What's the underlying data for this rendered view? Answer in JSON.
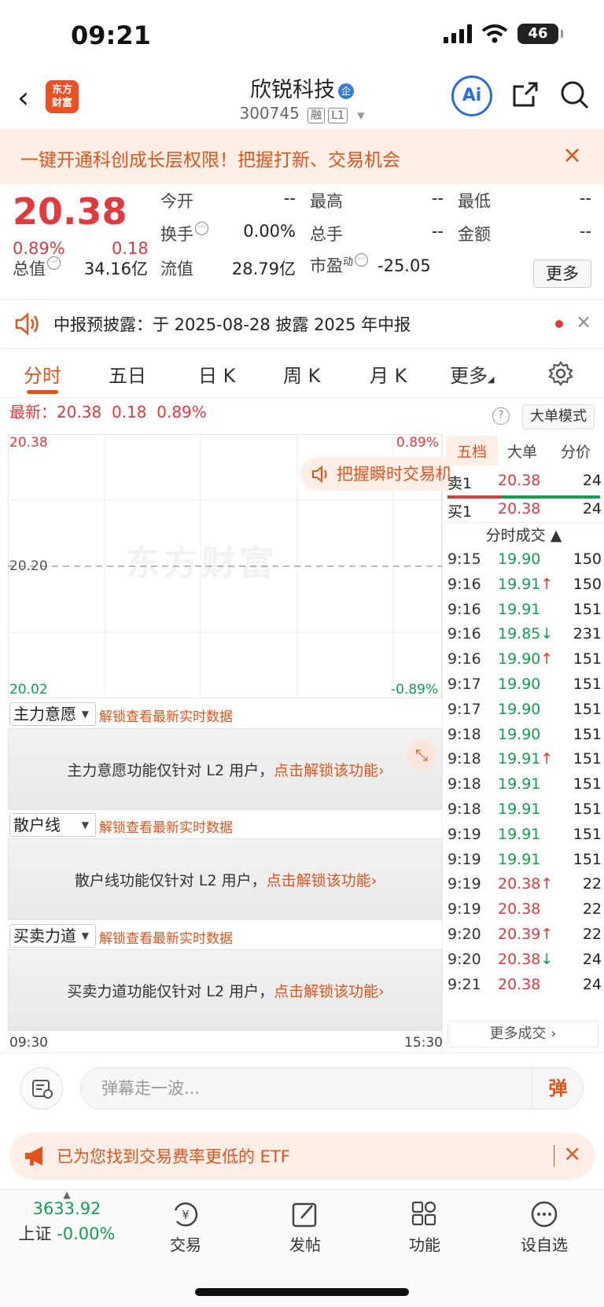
{
  "status": {
    "time": "09:21",
    "battery": "46"
  },
  "nav": {
    "back": "‹",
    "logo_line1": "东方",
    "logo_line2": "财富",
    "stock_name": "欣锐科技",
    "badge": "企",
    "stock_code": "300745",
    "tag_rong": "融",
    "tag_l1": "L1",
    "ai": "Ai"
  },
  "promo": {
    "text": "一键开通科创成长层权限！把握打新、交易机会",
    "close": "×"
  },
  "quote": {
    "price": "20.38",
    "pct": "0.89%",
    "chg": "0.18",
    "fields": [
      {
        "label": "今开",
        "value": "--"
      },
      {
        "label": "最高",
        "value": "--"
      },
      {
        "label": "最低",
        "value": "--"
      },
      {
        "label": "换手",
        "value": "0.00%"
      },
      {
        "label": "总手",
        "value": "--"
      },
      {
        "label": "金额",
        "value": "--"
      },
      {
        "label": "总值",
        "value": "34.16亿"
      },
      {
        "label": "流值",
        "value": "28.79亿"
      },
      {
        "label": "市盈",
        "sup": "动",
        "value": "-25.05"
      }
    ],
    "more": "更多"
  },
  "notice": {
    "text": "中报预披露：于 2025-08-28 披露 2025 年中报",
    "close": "×"
  },
  "tabs": [
    "分时",
    "五日",
    "日 K",
    "周 K",
    "月 K",
    "更多"
  ],
  "latest": {
    "label": "最新：",
    "price": "20.38",
    "chg": "0.18",
    "pct": "0.89%"
  },
  "bigmode": "大单模式",
  "help": "?",
  "chart": {
    "y_top": "20.38",
    "y_mid": "20.20",
    "y_bottom": "20.02",
    "pct_top": "0.89%",
    "pct_bottom": "-0.89%",
    "watermark": "东方财富",
    "pill": "把握瞬时交易机会",
    "time_start": "09:30",
    "time_end": "15:30"
  },
  "sections": [
    {
      "name": "主力意愿",
      "unlock": "解锁查看最新实时数据",
      "msg": "主力意愿功能仅针对 L2 用户，",
      "link": "点击解锁该功能›"
    },
    {
      "name": "散户线",
      "unlock": "解锁查看最新实时数据",
      "msg": "散户线功能仅针对 L2 用户，",
      "link": "点击解锁该功能›"
    },
    {
      "name": "买卖力道",
      "unlock": "解锁查看最新实时数据",
      "msg": "买卖力道功能仅针对 L2 用户，",
      "link": "点击解锁该功能›"
    }
  ],
  "right_panel": {
    "tabs": [
      "五档",
      "大单",
      "分价"
    ],
    "sell1": {
      "label": "卖1",
      "price": "20.38",
      "vol": "24"
    },
    "buy1": {
      "label": "买1",
      "price": "20.38",
      "vol": "24"
    },
    "ticks_title": "分时成交 ▲",
    "ticks": [
      {
        "t": "9:15",
        "p": "19.90",
        "arrow": "",
        "v": "150",
        "c": "green"
      },
      {
        "t": "9:16",
        "p": "19.91",
        "arrow": "↑",
        "v": "150",
        "c": "green"
      },
      {
        "t": "9:16",
        "p": "19.91",
        "arrow": "",
        "v": "151",
        "c": "green"
      },
      {
        "t": "9:16",
        "p": "19.85",
        "arrow": "↓",
        "v": "231",
        "c": "green"
      },
      {
        "t": "9:16",
        "p": "19.90",
        "arrow": "↑",
        "v": "151",
        "c": "green"
      },
      {
        "t": "9:17",
        "p": "19.90",
        "arrow": "",
        "v": "151",
        "c": "green"
      },
      {
        "t": "9:17",
        "p": "19.90",
        "arrow": "",
        "v": "151",
        "c": "green"
      },
      {
        "t": "9:18",
        "p": "19.90",
        "arrow": "",
        "v": "151",
        "c": "green"
      },
      {
        "t": "9:18",
        "p": "19.91",
        "arrow": "↑",
        "v": "151",
        "c": "green"
      },
      {
        "t": "9:18",
        "p": "19.91",
        "arrow": "",
        "v": "151",
        "c": "green"
      },
      {
        "t": "9:18",
        "p": "19.91",
        "arrow": "",
        "v": "151",
        "c": "green"
      },
      {
        "t": "9:19",
        "p": "19.91",
        "arrow": "",
        "v": "151",
        "c": "green"
      },
      {
        "t": "9:19",
        "p": "19.91",
        "arrow": "",
        "v": "151",
        "c": "green"
      },
      {
        "t": "9:19",
        "p": "20.38",
        "arrow": "↑",
        "v": "22",
        "c": "red"
      },
      {
        "t": "9:19",
        "p": "20.38",
        "arrow": "",
        "v": "22",
        "c": "red"
      },
      {
        "t": "9:20",
        "p": "20.39",
        "arrow": "↑",
        "v": "22",
        "c": "red"
      },
      {
        "t": "9:20",
        "p": "20.38",
        "arrow": "↓",
        "v": "24",
        "c": "red"
      },
      {
        "t": "9:21",
        "p": "20.38",
        "arrow": "",
        "v": "24",
        "c": "red"
      }
    ],
    "more_ticks": "更多成交 ›"
  },
  "danmu": {
    "placeholder": "弹幕走一波...",
    "send": "弹"
  },
  "etf": {
    "text": "已为您找到交易费率更低的 ETF",
    "close": "×"
  },
  "bottom_nav": {
    "index_value": "3633.92",
    "index_name": "上证",
    "index_pct": "-0.00%",
    "items": [
      "交易",
      "发帖",
      "功能",
      "设自选"
    ]
  },
  "colors": {
    "up": "#e4393c",
    "down": "#12a050",
    "accent": "#e2541c"
  }
}
